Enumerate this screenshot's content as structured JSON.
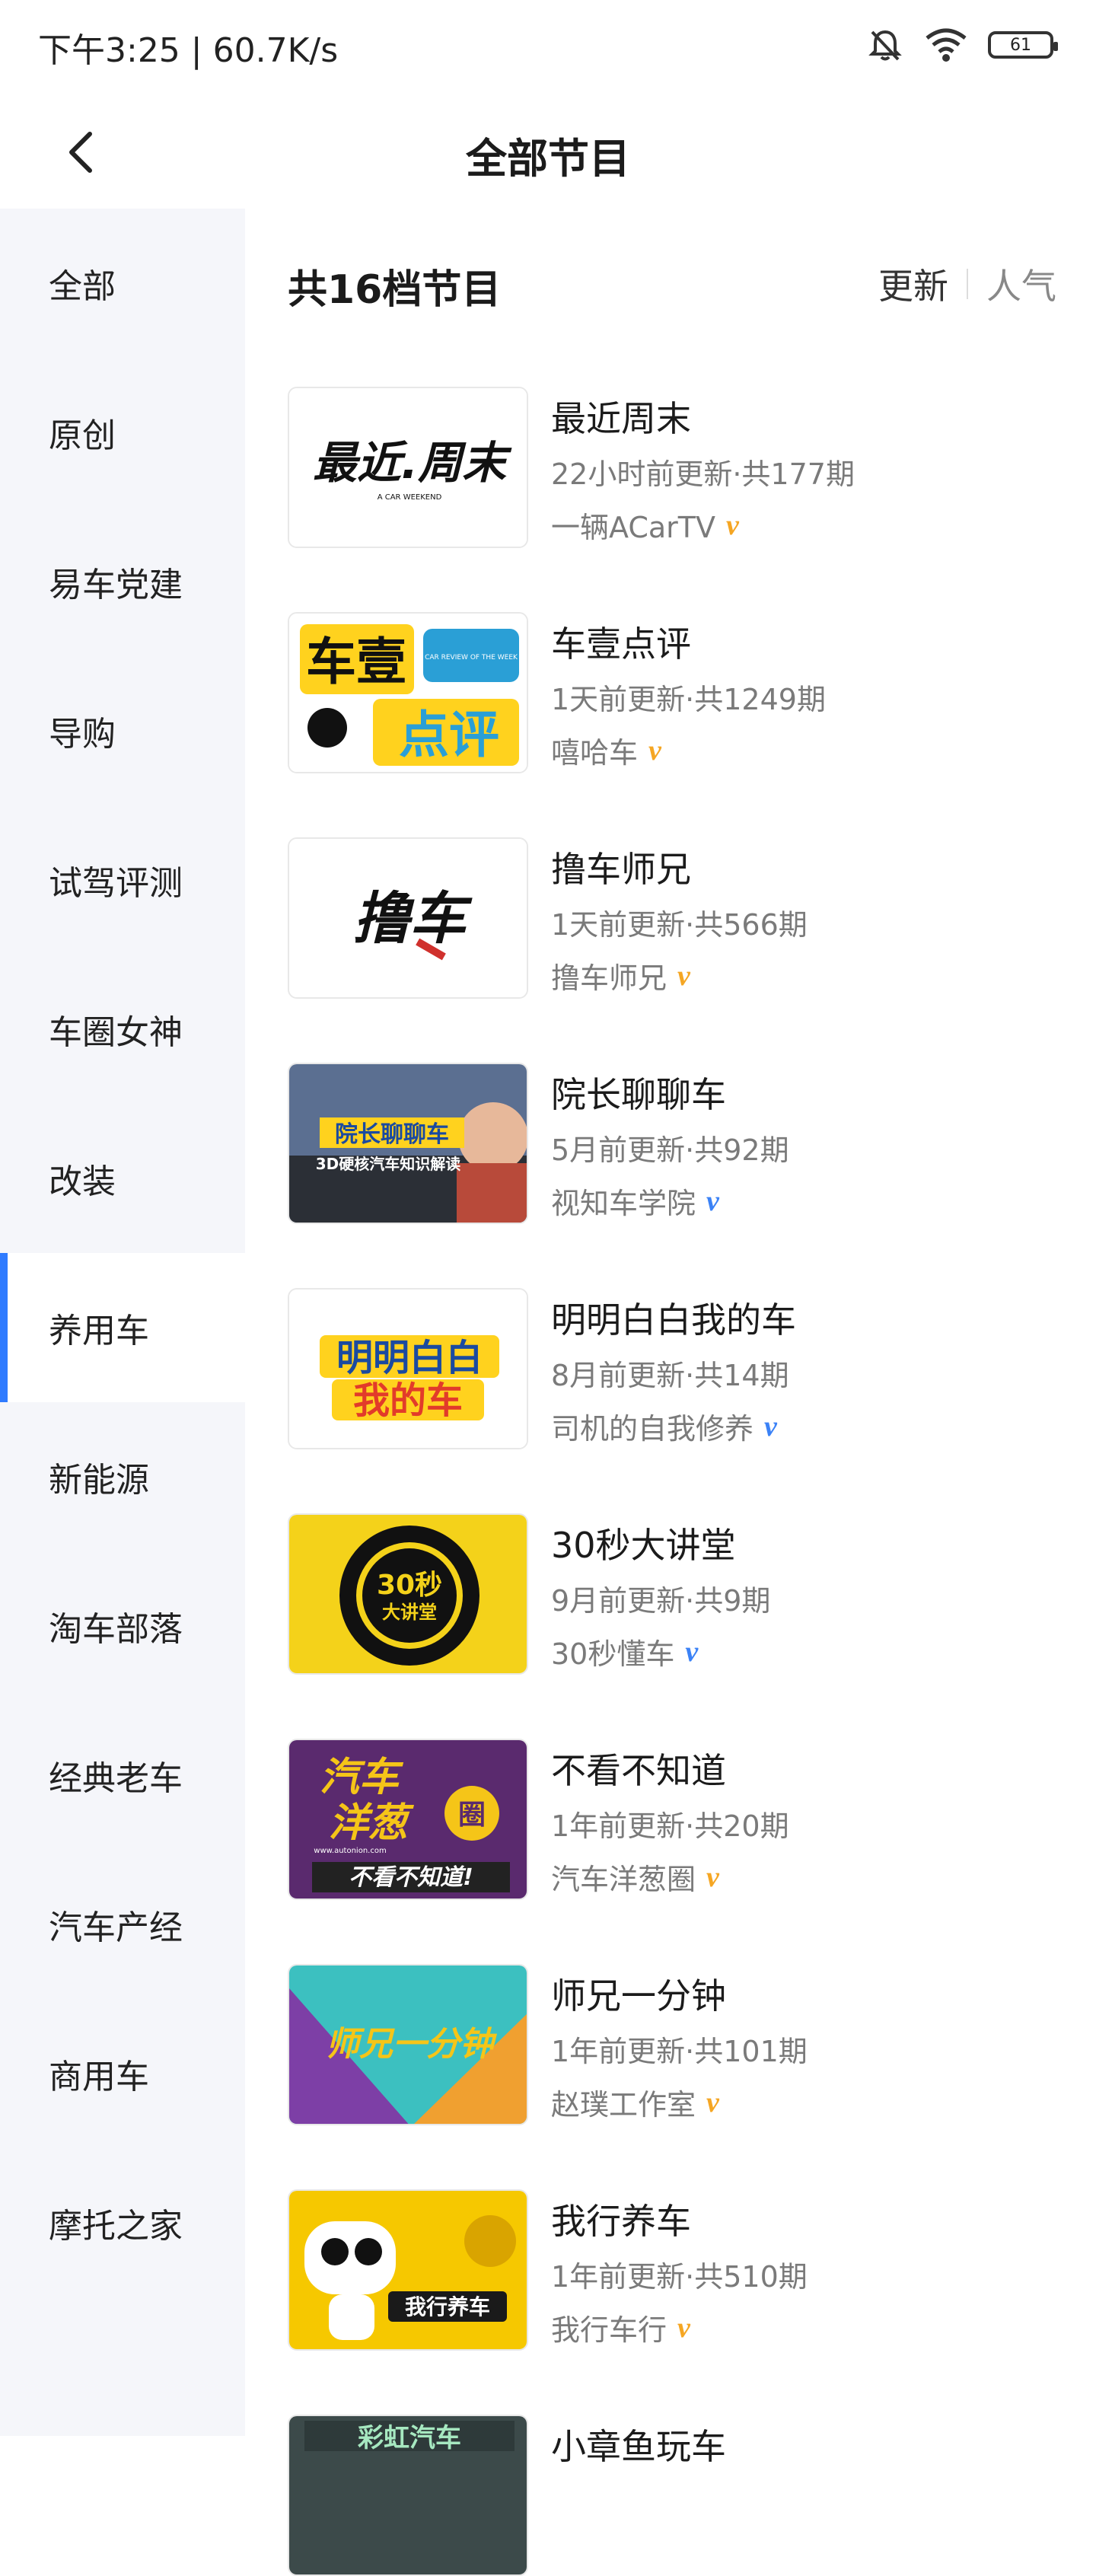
{
  "status": {
    "time_speed": "下午3:25 | 60.7K/s",
    "battery": "61",
    "icons": [
      "mute-bell-icon",
      "wifi-icon",
      "battery-icon"
    ]
  },
  "header": {
    "title": "全部节目",
    "back_icon": "chevron-left-icon"
  },
  "sidebar": {
    "active_index": 7,
    "items": [
      {
        "label": "全部"
      },
      {
        "label": "原创"
      },
      {
        "label": "易车党建"
      },
      {
        "label": "导购"
      },
      {
        "label": "试驾评测"
      },
      {
        "label": "车圈女神"
      },
      {
        "label": "改装"
      },
      {
        "label": "养用车"
      },
      {
        "label": "新能源"
      },
      {
        "label": "淘车部落"
      },
      {
        "label": "经典老车"
      },
      {
        "label": "汽车产经"
      },
      {
        "label": "商用车"
      },
      {
        "label": "摩托之家"
      }
    ]
  },
  "main": {
    "count_label": "共16档节目",
    "sort": {
      "update": "更新",
      "popular": "人气"
    },
    "programs": [
      {
        "name": "最近周末",
        "meta": "22小时前更新·共177期",
        "author": "一辆ACarTV",
        "badge": "v",
        "badge_color": "#f5a623",
        "thumb_text": "最近.周末",
        "thumb_sub": "A CAR WEEKEND"
      },
      {
        "name": "车壹点评",
        "meta": "1天前更新·共1249期",
        "author": "嘻哈车",
        "badge": "v",
        "badge_color": "#f5a623",
        "thumb_text": "车壹",
        "thumb_text2": "点评",
        "thumb_sub": "CAR REVIEW OF THE WEEK"
      },
      {
        "name": "撸车师兄",
        "meta": "1天前更新·共566期",
        "author": "撸车师兄",
        "badge": "v",
        "badge_color": "#f5a623",
        "thumb_text": "撸车"
      },
      {
        "name": "院长聊聊车",
        "meta": "5月前更新·共92期",
        "author": "视知车学院",
        "badge": "v",
        "badge_color": "#3b82f6",
        "thumb_text": "院长聊聊车",
        "thumb_sub": "3D硬核汽车知识解读"
      },
      {
        "name": "明明白白我的车",
        "meta": "8月前更新·共14期",
        "author": "司机的自我修养",
        "badge": "v",
        "badge_color": "#3b82f6",
        "thumb_text": "明明白白",
        "thumb_text2": "我的车"
      },
      {
        "name": "30秒大讲堂",
        "meta": "9月前更新·共9期",
        "author": "30秒懂车",
        "badge": "v",
        "badge_color": "#3b82f6",
        "thumb_text": "30秒",
        "thumb_text2": "大讲堂"
      },
      {
        "name": "不看不知道",
        "meta": "1年前更新·共20期",
        "author": "汽车洋葱圈",
        "badge": "v",
        "badge_color": "#f5a623",
        "thumb_text": "汽车",
        "thumb_text2": "洋葱",
        "thumb_text3": "不看不知道!",
        "thumb_sub": "www.autonion.com",
        "thumb_badge": "圈"
      },
      {
        "name": "师兄一分钟",
        "meta": "1年前更新·共101期",
        "author": "赵璞工作室",
        "badge": "v",
        "badge_color": "#f5a623",
        "thumb_text": "师兄一分钟"
      },
      {
        "name": "我行养车",
        "meta": "1年前更新·共510期",
        "author": "我行车行",
        "badge": "v",
        "badge_color": "#f5a623",
        "thumb_text": "我行养车"
      },
      {
        "name": "小章鱼玩车",
        "meta": "",
        "author": "",
        "badge": "",
        "badge_color": "#f5a623",
        "thumb_text": "彩虹汽车"
      }
    ]
  }
}
